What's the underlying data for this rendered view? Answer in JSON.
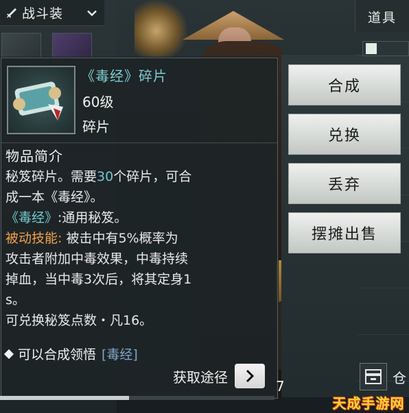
{
  "outfit": {
    "label": "战斗装",
    "icon": "sword-icon",
    "dropdown_icon": "chevron-down-icon"
  },
  "tab": {
    "label": "道具"
  },
  "item": {
    "name": "《毒经》碎片",
    "level": "60级",
    "type": "碎片",
    "icon": "scroll-icon"
  },
  "description": {
    "heading": "物品简介",
    "line1_a": "秘笈碎片。需要",
    "line1_num": "30",
    "line1_b": "个碎片，可合",
    "line2": "成一本《毒经》。",
    "line3_a": "《毒经》",
    "line3_b": ":通用秘笈。",
    "passive_label": "被动技能:",
    "passive_a": "被击中有5%概率为",
    "passive_b": "攻击者附加中毒效果，中毒持续",
    "passive_c": "掉血，当中毒3次后，将其定身1",
    "passive_d": "s。",
    "exchange": "可兑换秘笈点数・凡16。"
  },
  "compose": {
    "prefix": "可以合成领悟",
    "skill": "[毒经]"
  },
  "obtain": {
    "label": "获取途径",
    "icon": "chevron-right-icon"
  },
  "actions": {
    "compose": "合成",
    "exchange": "兑换",
    "discard": "丢弃",
    "sell": "摆摊出售"
  },
  "bottom": {
    "number": "7",
    "warehouse_label": "仓",
    "progress": 0.47
  },
  "watermark": {
    "text": "天成手游网"
  },
  "colors": {
    "teal": "#6fc9cf",
    "orange": "#f0a24a",
    "panel_bg": "#1e2426"
  }
}
